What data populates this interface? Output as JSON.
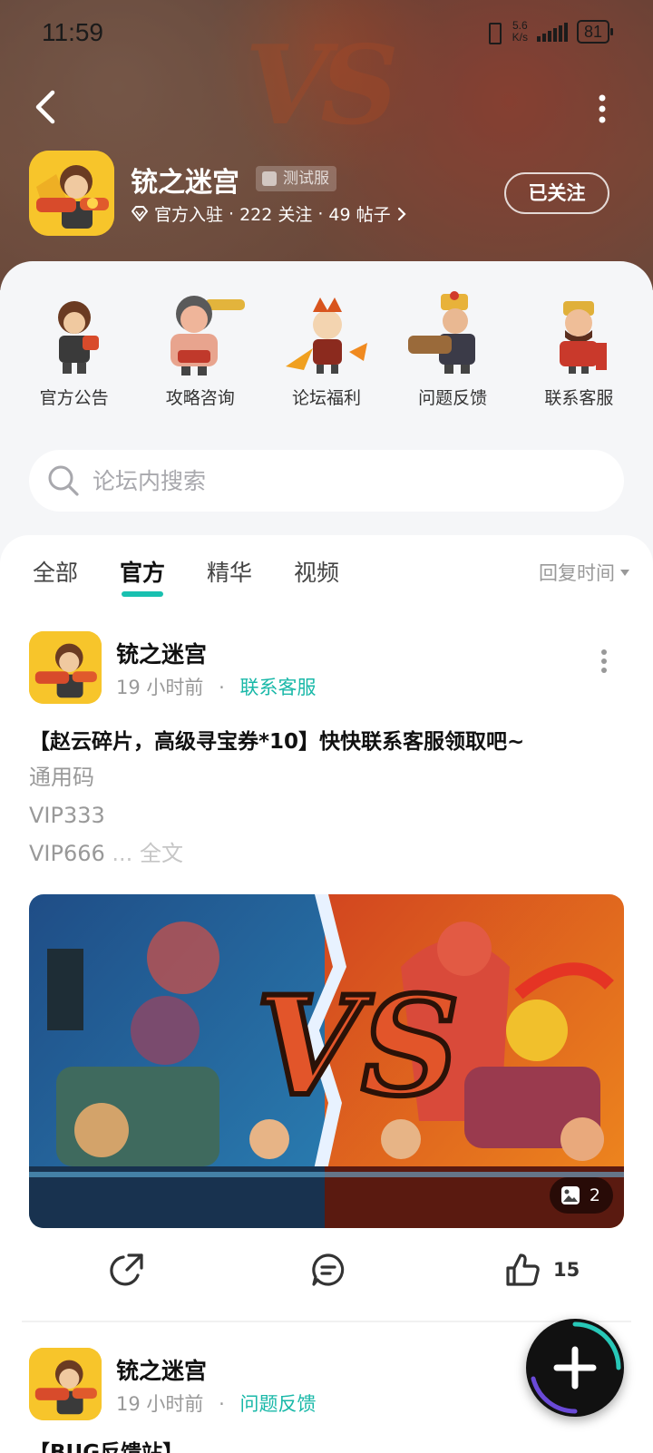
{
  "status_bar": {
    "time": "11:59",
    "net_speed_value": "5.6",
    "net_speed_unit": "K/s",
    "battery": "81"
  },
  "forum": {
    "name": "铳之迷宫",
    "badge": "测试服",
    "meta_official": "官方入驻",
    "meta_followers": "222 关注",
    "meta_posts": "49 帖子",
    "meta_sep": "·",
    "follow_label": "已关注"
  },
  "shortcuts": [
    {
      "label": "官方公告"
    },
    {
      "label": "攻略咨询"
    },
    {
      "label": "论坛福利"
    },
    {
      "label": "问题反馈"
    },
    {
      "label": "联系客服"
    }
  ],
  "search": {
    "placeholder": "论坛内搜索",
    "value": ""
  },
  "tabs": [
    {
      "label": "全部",
      "active": false
    },
    {
      "label": "官方",
      "active": true
    },
    {
      "label": "精华",
      "active": false
    },
    {
      "label": "视频",
      "active": false
    }
  ],
  "sort_label": "回复时间",
  "posts": [
    {
      "author": "铳之迷宫",
      "time": "19 小时前",
      "sep": "·",
      "category": "联系客服",
      "title": "【赵云碎片，高级寻宝券*10】快快联系客服领取吧~",
      "body_lines": [
        "通用码",
        "VIP333",
        "VIP666"
      ],
      "ellipsis": "...",
      "full_text_label": "全文",
      "image_count": "2",
      "like_count": "15"
    },
    {
      "author": "铳之迷宫",
      "time": "19 小时前",
      "sep": "·",
      "category": "问题反馈",
      "title": "【BUG反馈站】"
    }
  ],
  "colors": {
    "accent": "#19c0b0",
    "banner": "#7a5646",
    "panel_bg": "#f5f6f8"
  },
  "icons": [
    "back-arrow-icon",
    "more-vertical-icon",
    "verified-diamond-icon",
    "chevron-right-icon",
    "search-icon",
    "share-icon",
    "comment-icon",
    "like-icon",
    "image-icon",
    "plus-icon"
  ]
}
